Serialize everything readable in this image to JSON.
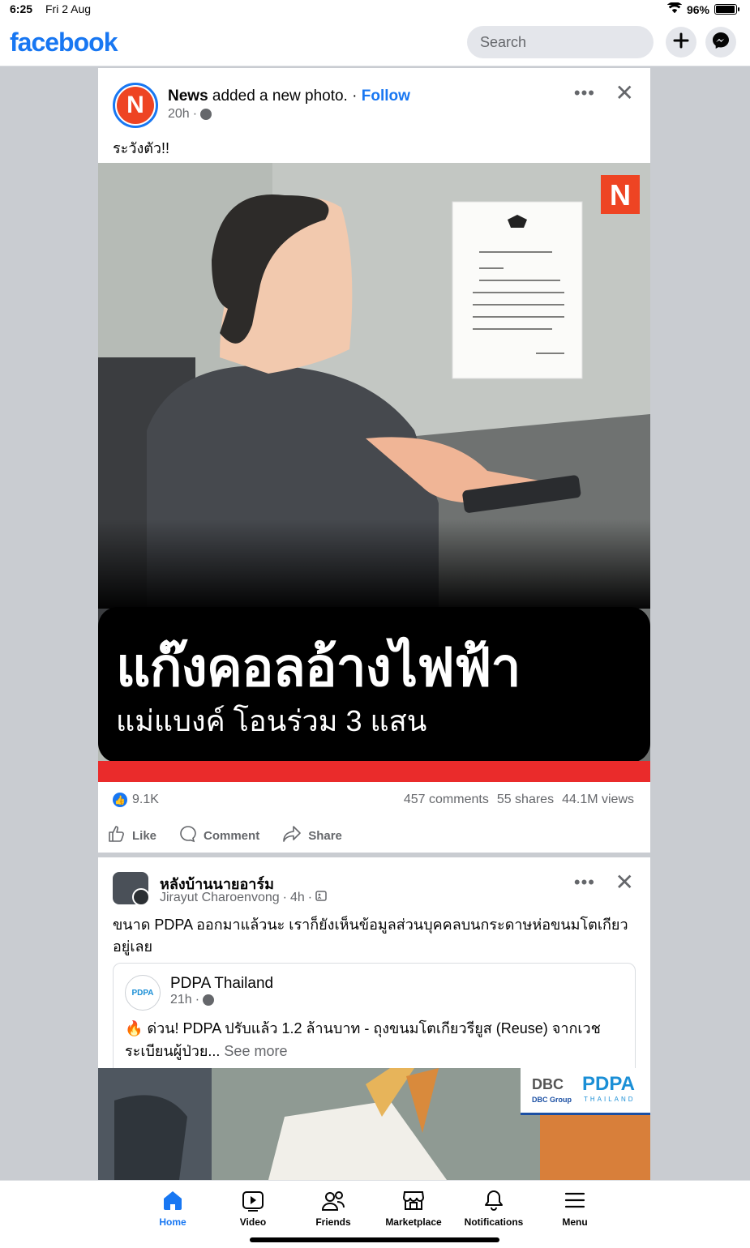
{
  "status": {
    "time": "6:25",
    "date": "Fri 2 Aug",
    "battery": "96%",
    "battery_level": 0.96
  },
  "header": {
    "logo": "facebook",
    "search_placeholder": "Search"
  },
  "post1": {
    "page_name": "News",
    "action": "added a new photo.",
    "follow": "Follow",
    "time": "20h",
    "caption": "ระวังตัว!!",
    "photo": {
      "badge": "N",
      "headline": "แก๊งคอลอ้างไฟฟ้า",
      "subline": "แม่แบงค์ โอนร่วม 3 แสน"
    },
    "likes": "9.1K",
    "comments": "457 comments",
    "shares": "55 shares",
    "views": "44.1M views",
    "actions": {
      "like": "Like",
      "comment": "Comment",
      "share": "Share"
    }
  },
  "post2": {
    "group_name": "หลังบ้านนายอาร์ม",
    "author": "Jirayut Charoenvong",
    "time": "4h",
    "text": "ขนาด PDPA ออกมาแล้วนะ เราก็ยังเห็นข้อมูลส่วนบุคคลบนกระดาษห่อขนมโตเกียวอยู่เลย",
    "shared": {
      "avatar": "PDPA",
      "page_name": "PDPA Thailand",
      "time": "21h",
      "emoji": "🔥",
      "text": "ด่วน! PDPA ปรับแล้ว 1.2 ล้านบาท - ถุงขนมโตเกียวรียูส (Reuse) จากเวชระเบียนผู้ป่วย...",
      "see_more": "See more",
      "logo": {
        "dbc": "DBC",
        "dbc_group": "DBC Group",
        "pdpa": "PDPA",
        "thailand": "THAILAND"
      }
    }
  },
  "tabs": [
    {
      "label": "Home",
      "icon": "home-icon",
      "active": true
    },
    {
      "label": "Video",
      "icon": "video-icon"
    },
    {
      "label": "Friends",
      "icon": "friends-icon"
    },
    {
      "label": "Marketplace",
      "icon": "marketplace-icon"
    },
    {
      "label": "Notifications",
      "icon": "bell-icon"
    },
    {
      "label": "Menu",
      "icon": "menu-icon"
    }
  ],
  "colors": {
    "brand": "#1877f2",
    "news_red": "#ee4423"
  }
}
